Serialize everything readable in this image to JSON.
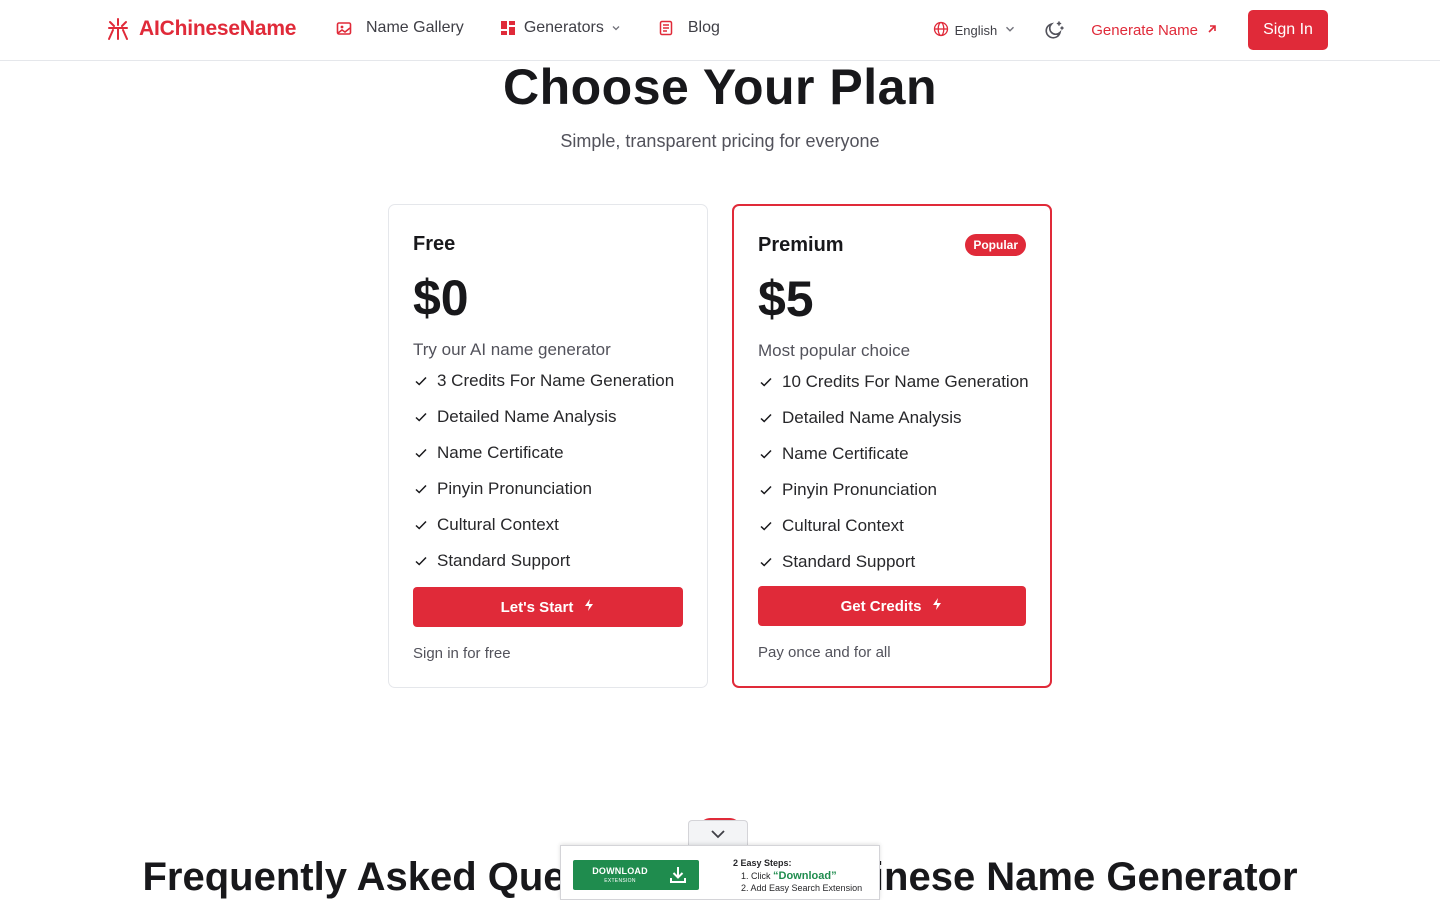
{
  "header": {
    "brand": "AIChineseName",
    "nav": [
      {
        "label": "Name Gallery",
        "icon": "gallery-icon"
      },
      {
        "label": "Generators",
        "icon": "grid-icon"
      },
      {
        "label": "Blog",
        "icon": "document-icon"
      }
    ],
    "language": "English",
    "generate_link": "Generate Name",
    "signin": "Sign In"
  },
  "hero": {
    "title": "Choose Your Plan",
    "subtitle": "Simple, transparent pricing for everyone"
  },
  "plans": [
    {
      "name": "Free",
      "price": "$0",
      "description": "Try our AI name generator",
      "features": [
        "3 Credits For Name Generation",
        "Detailed Name Analysis",
        "Name Certificate",
        "Pinyin Pronunciation",
        "Cultural Context",
        "Standard Support"
      ],
      "cta": "Let's Start",
      "footnote": "Sign in for free"
    },
    {
      "name": "Premium",
      "badge": "Popular",
      "price": "$5",
      "description": "Most popular choice",
      "features": [
        "10 Credits For Name Generation",
        "Detailed Name Analysis",
        "Name Certificate",
        "Pinyin Pronunciation",
        "Cultural Context",
        "Standard Support"
      ],
      "cta": "Get Credits",
      "footnote": "Pay once and for all"
    }
  ],
  "faq": {
    "title": "Frequently Asked Questions About Chinese Name Generator"
  },
  "ad": {
    "button_main": "DOWNLOAD",
    "button_sub": "EXTENSION",
    "steps_title": "2 Easy Steps:",
    "step1_prefix": "1. Click ",
    "step1_highlight": "“Download”",
    "step2": "2. Add Easy Search Extension"
  },
  "colors": {
    "accent": "#e02a39",
    "ad_green": "#1f8c4e"
  }
}
